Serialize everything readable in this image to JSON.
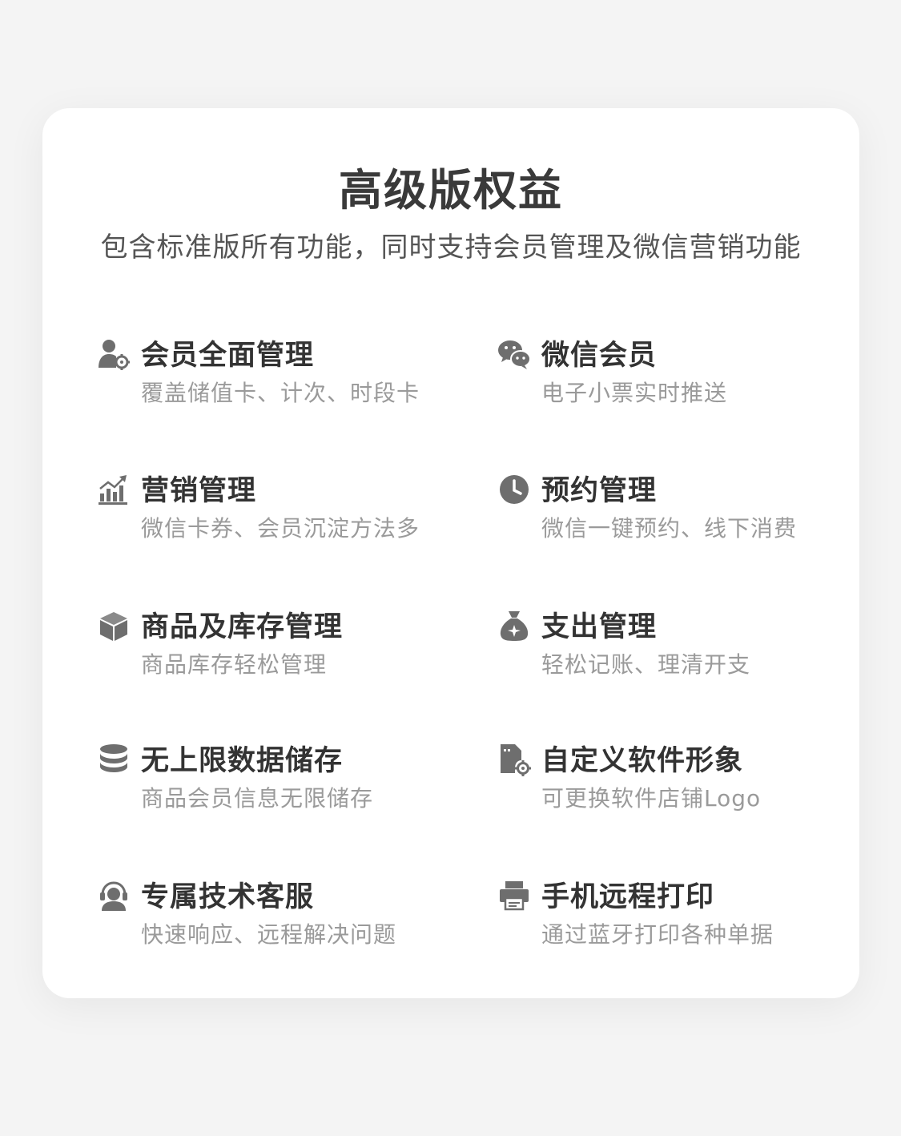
{
  "card": {
    "title": "高级版权益",
    "subtitle": "包含标准版所有功能，同时支持会员管理及微信营销功能"
  },
  "features": [
    {
      "icon": "user-gear-icon",
      "title": "会员全面管理",
      "desc": "覆盖储值卡、计次、时段卡"
    },
    {
      "icon": "wechat-icon",
      "title": "微信会员",
      "desc": "电子小票实时推送"
    },
    {
      "icon": "chart-growth-icon",
      "title": "营销管理",
      "desc": "微信卡券、会员沉淀方法多"
    },
    {
      "icon": "clock-icon",
      "title": "预约管理",
      "desc": "微信一键预约、线下消费"
    },
    {
      "icon": "box-icon",
      "title": "商品及库存管理",
      "desc": "商品库存轻松管理"
    },
    {
      "icon": "money-bag-icon",
      "title": "支出管理",
      "desc": "轻松记账、理清开支"
    },
    {
      "icon": "database-icon",
      "title": "无上限数据储存",
      "desc": "商品会员信息无限储存"
    },
    {
      "icon": "file-gear-icon",
      "title": "自定义软件形象",
      "desc": "可更换软件店铺Logo"
    },
    {
      "icon": "headset-icon",
      "title": "专属技术客服",
      "desc": "快速响应、远程解决问题"
    },
    {
      "icon": "printer-icon",
      "title": "手机远程打印",
      "desc": "通过蓝牙打印各种单据"
    }
  ],
  "colors": {
    "icon": "#6e6e6e",
    "title": "#333333",
    "desc": "#9a9a9a",
    "background": "#f4f4f4",
    "card": "#ffffff"
  }
}
